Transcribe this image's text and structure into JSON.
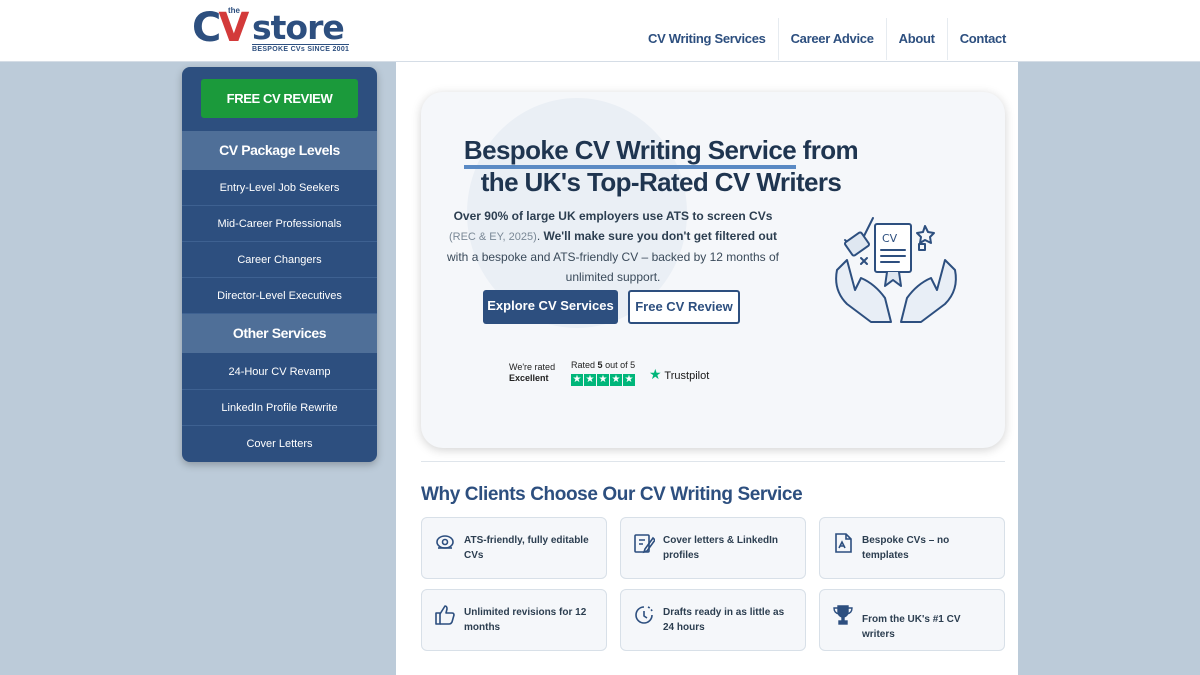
{
  "header": {
    "logo": {
      "the": "the",
      "cv_c": "C",
      "cv_v": "V",
      "store": "store",
      "tagline": "BESPOKE CVs SINCE 2001"
    },
    "nav": [
      "CV Writing Services",
      "Career Advice",
      "About",
      "Contact"
    ]
  },
  "sidebar": {
    "free_review": "FREE CV REVIEW",
    "packages_heading": "CV Package Levels",
    "packages": [
      "Entry-Level Job Seekers",
      "Mid-Career Professionals",
      "Career Changers",
      "Director-Level Executives"
    ],
    "other_heading": "Other Services",
    "other": [
      "24-Hour CV Revamp",
      "LinkedIn Profile Rewrite",
      "Cover Letters"
    ]
  },
  "hero": {
    "title_highlight": "Bespoke CV Writing Service",
    "title_rest_1": " from",
    "title_line2": "the UK's Top-Rated CV Writers",
    "body_bold1": "Over 90% of large UK employers use ATS to screen CVs",
    "body_muted": "(REC & EY, 2025)",
    "body_dot": ".",
    "body_bold2": "We'll make sure you don't get filtered out",
    "body_rest": "with a bespoke and ATS-friendly CV – backed by 12 months of unlimited support.",
    "btn_explore": "Explore CV Services",
    "btn_free": "Free CV Review",
    "trustpilot": {
      "rated_line1": "We're rated",
      "rated_line2": "Excellent",
      "score_pre": "Rated",
      "score_val": "5",
      "score_post": "out of 5",
      "brand": "Trustpilot"
    }
  },
  "why": {
    "title": "Why Clients Choose Our CV Writing Service",
    "cards": [
      {
        "icon": "ats-scan-icon",
        "text": "ATS-friendly, fully editable CVs"
      },
      {
        "icon": "edit-document-icon",
        "text": "Cover letters & LinkedIn profiles"
      },
      {
        "icon": "bespoke-file-icon",
        "text": "Bespoke CVs – no templates"
      },
      {
        "icon": "thumbs-up-icon",
        "text": "Unlimited revisions for 12 months"
      },
      {
        "icon": "clock-icon",
        "text": "Drafts ready in as little as 24 hours"
      },
      {
        "icon": "trophy-icon",
        "text": "From the UK's #1 CV writers"
      }
    ]
  },
  "colors": {
    "brand_navy": "#2d4f7f",
    "brand_red": "#d33a3a",
    "cta_green": "#1b9a3b",
    "trustpilot_green": "#00b67a",
    "page_bg": "#bccbd9"
  }
}
